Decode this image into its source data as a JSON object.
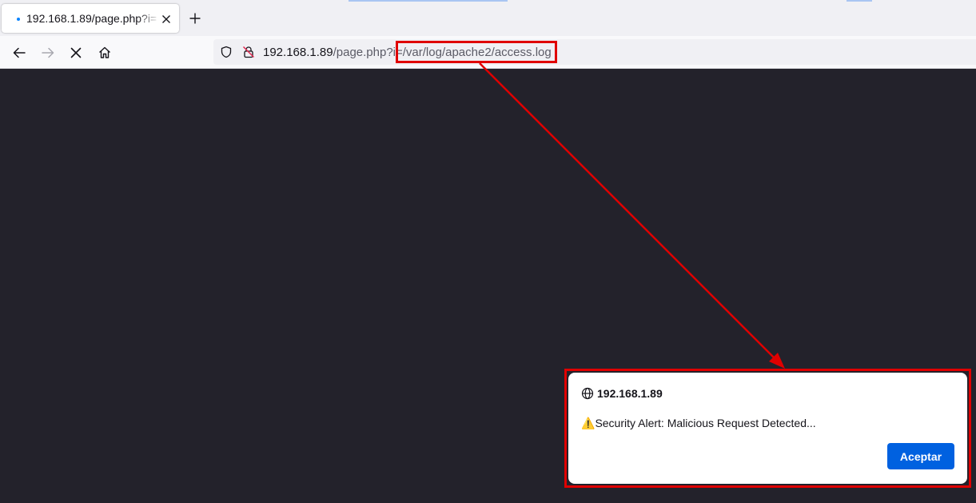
{
  "tab": {
    "title": "192.168.1.89/page.php?i="
  },
  "urlbar": {
    "host": "192.168.1.89",
    "path": "/page.php?i=/var/log/apache2/access.log"
  },
  "dialog": {
    "origin": "192.168.1.89",
    "warning_glyph": "⚠️",
    "message": "Security Alert: Malicious Request Detected...",
    "ok_label": "Aceptar"
  },
  "colors": {
    "page_background": "#23222b",
    "annotation_red": "#e00000",
    "primary_button": "#0061e0",
    "loading_dot": "#0a84ff"
  },
  "icons": [
    "close-icon",
    "plus-icon",
    "back-arrow-icon",
    "forward-arrow-icon",
    "stop-icon",
    "home-icon",
    "shield-icon",
    "insecure-lock-icon",
    "globe-icon",
    "warning-icon"
  ]
}
